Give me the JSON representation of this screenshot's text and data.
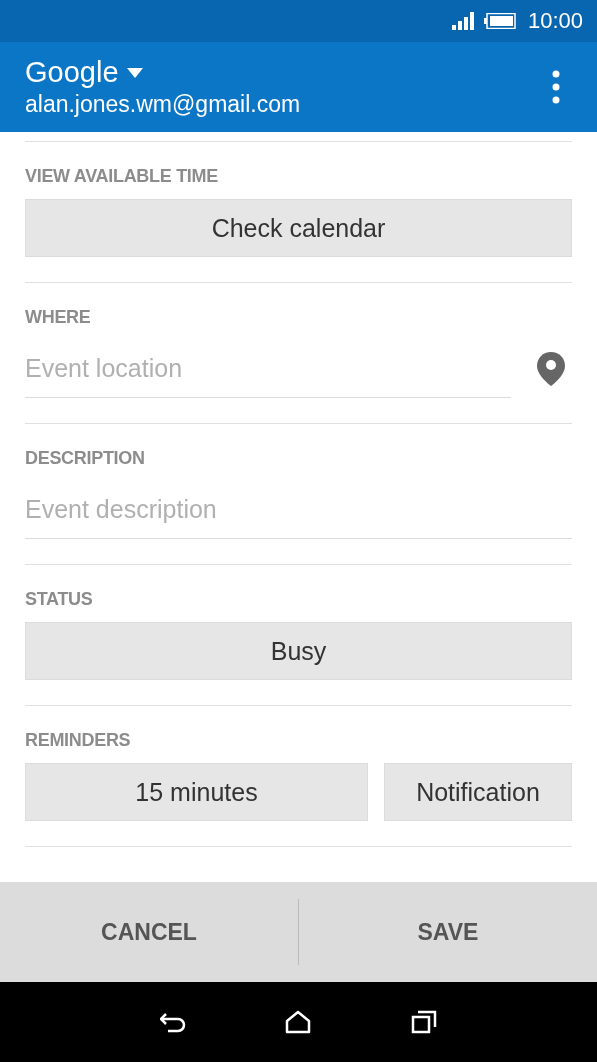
{
  "status_bar": {
    "time": "10:00"
  },
  "header": {
    "account": "Google",
    "email": "alan.jones.wm@gmail.com"
  },
  "sections": [
    {
      "kind": "button",
      "label": "VIEW AVAILABLE TIME",
      "value": "Check calendar"
    },
    {
      "kind": "location_field",
      "label": "WHERE",
      "placeholder": "Event location"
    },
    {
      "kind": "field",
      "label": "DESCRIPTION",
      "placeholder": "Event description"
    },
    {
      "kind": "button",
      "label": "STATUS",
      "value": "Busy"
    },
    {
      "kind": "pair",
      "label": "REMINDERS",
      "values": [
        "15 minutes",
        "Notification"
      ]
    }
  ],
  "actions": [
    "CANCEL",
    "SAVE"
  ]
}
